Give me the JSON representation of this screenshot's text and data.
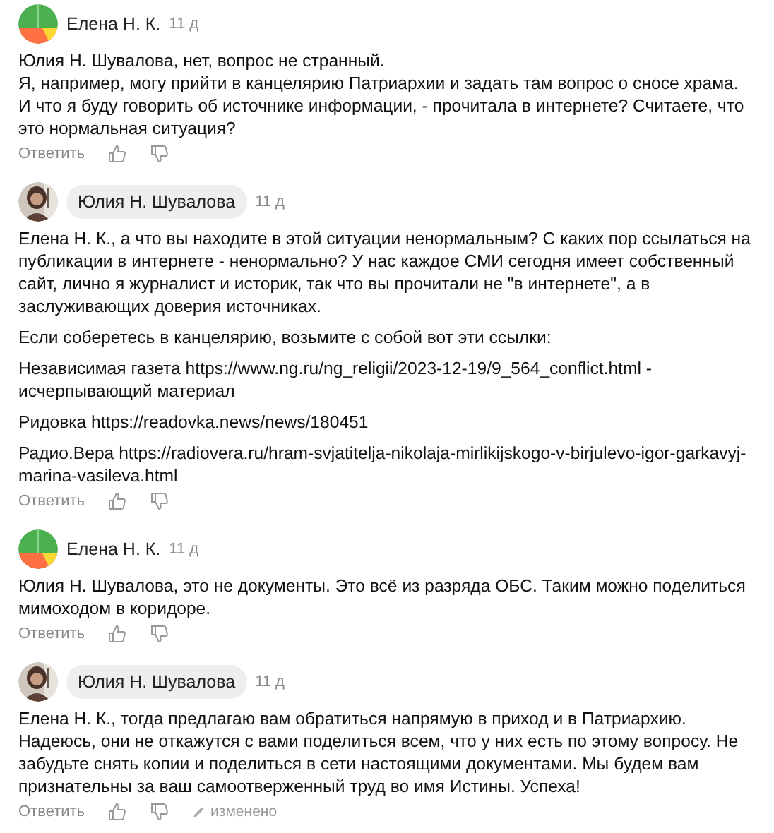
{
  "comments": [
    {
      "author": "Елена Н. К.",
      "author_badge": false,
      "kind": "pattern",
      "time": "11 д",
      "paragraphs": [
        "Юлия Н. Шувалова, нет, вопрос не странный.\nЯ, например, могу прийти в канцелярию Патриархии и задать там вопрос о сносе храма. И что я буду говорить об источнике информации, - прочитала в интернете? Считаете, что это нормальная ситуация?"
      ],
      "reply": "Ответить",
      "edited": false
    },
    {
      "author": "Юлия Н. Шувалова",
      "author_badge": true,
      "kind": "picture",
      "time": "11 д",
      "paragraphs": [
        "Елена Н. К., а что вы находите в этой ситуации ненормальным? С каких пор ссылаться на публикации в интернете - ненормально? У нас каждое СМИ сегодня имеет собственный сайт, лично я журналист и историк, так что вы прочитали не \"в интернете\", а в заслуживающих доверия источниках.",
        "Если соберетесь в канцелярию, возьмите с собой вот эти ссылки:",
        "Независимая газета https://www.ng.ru/ng_religii/2023-12-19/9_564_conflict.html - исчерпывающий материал",
        "Ридовка https://readovka.news/news/180451",
        "Радио.Вера https://radiovera.ru/hram-svjatitelja-nikolaja-mirlikijskogo-v-birjulevo-igor-garkavyj-marina-vasileva.html"
      ],
      "reply": "Ответить",
      "edited": false
    },
    {
      "author": "Елена Н. К.",
      "author_badge": false,
      "kind": "pattern",
      "time": "11 д",
      "paragraphs": [
        "Юлия Н. Шувалова, это не документы. Это всё из разряда ОБС. Таким можно поделиться мимоходом в коридоре."
      ],
      "reply": "Ответить",
      "edited": false
    },
    {
      "author": "Юлия Н. Шувалова",
      "author_badge": true,
      "kind": "picture",
      "time": "11 д",
      "paragraphs": [
        "Елена Н. К., тогда предлагаю вам обратиться напрямую в приход и в Патриархию. Надеюсь, они не откажутся с вами поделиться всем, что у них есть по этому вопросу. Не забудьте снять копии и поделиться в сети настоящими документами. Мы будем вам признательны за ваш самоотверженный труд во имя Истины. Успеха!"
      ],
      "reply": "Ответить",
      "edited": true,
      "edited_label": "изменено"
    }
  ]
}
